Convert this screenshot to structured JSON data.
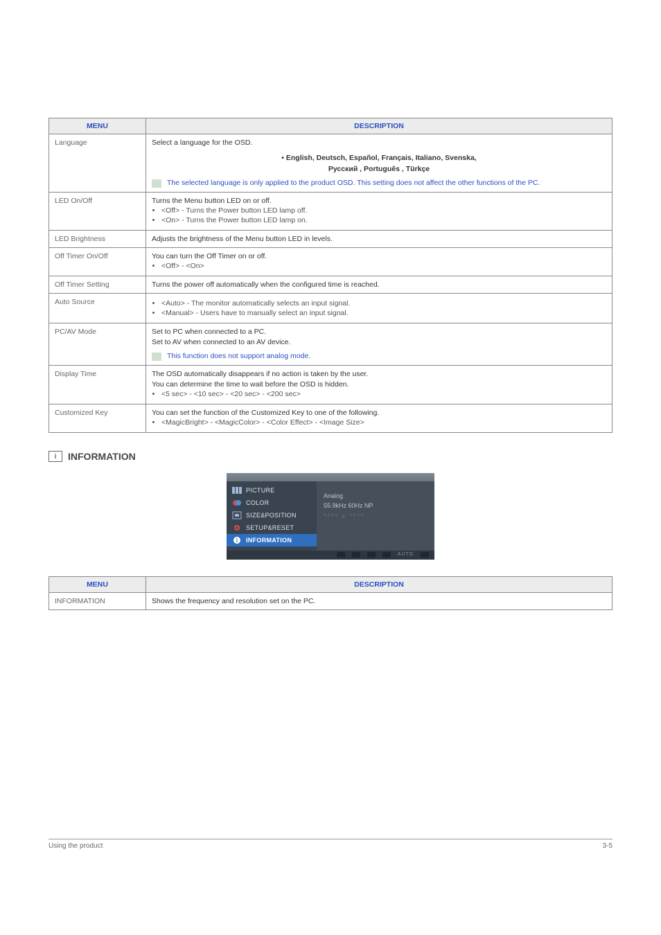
{
  "table1": {
    "headers": {
      "menu": "MENU",
      "desc": "DESCRIPTION"
    },
    "language": {
      "label": "Language",
      "intro": "Select a language for the OSD.",
      "langs_line1": "• English, Deutsch, Español, Français,  Italiano, Svenska,",
      "langs_line2": "Русский , Português , Türkçe",
      "note": "The selected language is only applied to the product OSD. This setting does not affect the other functions of the PC."
    },
    "led_onoff": {
      "label": "LED On/Off",
      "intro": "Turns the Menu button LED on or off.",
      "b1": "<Off> - Turns the Power button LED lamp off.",
      "b2": "<On> - Turns the Power button LED lamp on."
    },
    "led_brightness": {
      "label": "LED Brightness",
      "desc": "Adjusts the brightness of the Menu button LED in levels."
    },
    "off_timer_onoff": {
      "label": "Off Timer On/Off",
      "intro": "You can turn the Off Timer on or off.",
      "b1": "<Off> - <On>"
    },
    "off_timer_setting": {
      "label": "Off Timer Setting",
      "desc": "Turns the power off automatically when the configured time is reached."
    },
    "auto_source": {
      "label": "Auto Source",
      "b1": "<Auto> - The monitor automatically selects an input signal.",
      "b2": "<Manual> - Users have to manually select an input signal."
    },
    "pcav": {
      "label": "PC/AV Mode",
      "l1": "Set to PC when connected to a PC.",
      "l2": "Set to AV when connected to an AV device.",
      "note": "This function does not support analog mode."
    },
    "display_time": {
      "label": "Display Time",
      "l1": "The OSD automatically disappears if no action is taken by the user.",
      "l2": "You can determine the time to wait before the OSD is hidden.",
      "b1": "<5 sec> - <10 sec> - <20 sec> - <200 sec>"
    },
    "custom_key": {
      "label": "Customized Key",
      "l1": "You can set the function of the Customized Key to one of the following.",
      "b1": "<MagicBright> - <MagicColor> - <Color Effect> - <Image Size>"
    }
  },
  "info_section": {
    "heading": "INFORMATION",
    "osd": {
      "picture": "PICTURE",
      "color": "COLOR",
      "sizepos": "SIZE&POSITION",
      "setup": "SETUP&RESET",
      "information": "INFORMATION",
      "right1": "Analog",
      "right2": "55.9kHz 60Hz NP",
      "right3": "**** x ****",
      "auto": "AUTO"
    }
  },
  "table2": {
    "headers": {
      "menu": "MENU",
      "desc": "DESCRIPTION"
    },
    "row": {
      "label": "INFORMATION",
      "desc": "Shows the frequency and resolution set on the PC."
    }
  },
  "footer": {
    "left": "Using the product",
    "right": "3-5"
  }
}
